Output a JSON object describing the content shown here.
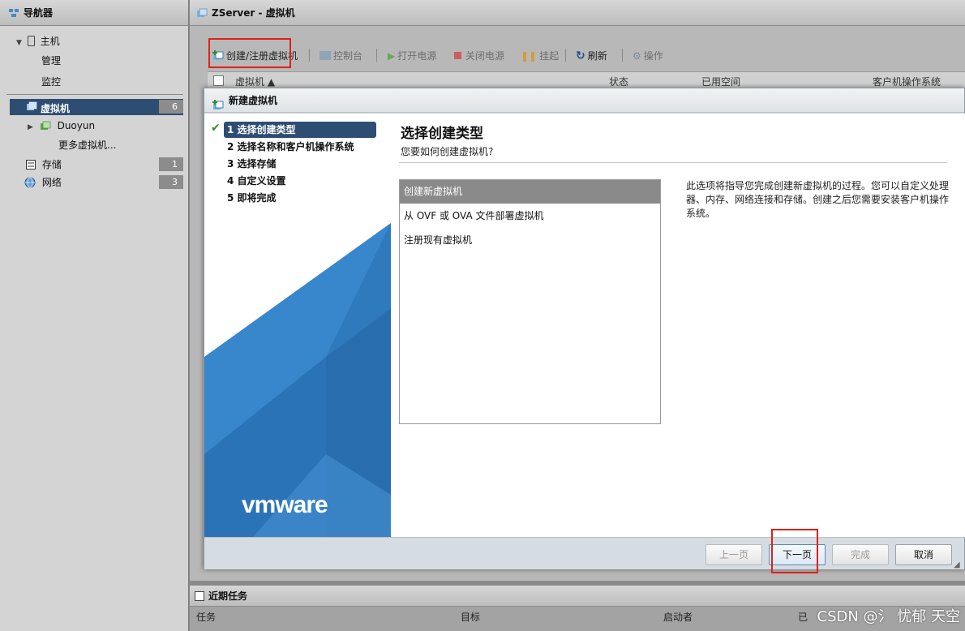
{
  "navigator": {
    "title": "导航器",
    "host": {
      "label": "主机",
      "children": [
        "管理",
        "监控"
      ]
    },
    "vms": {
      "label": "虚拟机",
      "count": "6",
      "children": [
        "Duoyun",
        "更多虚拟机..."
      ]
    },
    "storage": {
      "label": "存储",
      "count": "1"
    },
    "network": {
      "label": "网络",
      "count": "3"
    }
  },
  "main": {
    "title": "ZServer - 虚拟机",
    "toolbar": {
      "create": "创建/注册虚拟机",
      "console": "控制台",
      "power_on": "打开电源",
      "power_off": "关闭电源",
      "suspend": "挂起",
      "refresh": "刷新",
      "actions": "操作"
    },
    "columns": [
      "虚拟机 ▲",
      "状态",
      "已用空间",
      "客户机操作系统"
    ]
  },
  "tasks": {
    "title": "近期任务",
    "columns": [
      "任务",
      "目标",
      "启动者",
      "已"
    ]
  },
  "dialog": {
    "title": "新建虚拟机",
    "steps": [
      "1 选择创建类型",
      "2 选择名称和客户机操作系统",
      "3 选择存储",
      "4 自定义设置",
      "5 即将完成"
    ],
    "heading": "选择创建类型",
    "subheading": "您要如何创建虚拟机?",
    "options": [
      "创建新虚拟机",
      "从 OVF 或 OVA 文件部署虚拟机",
      "注册现有虚拟机"
    ],
    "selected_option": 0,
    "description": "此选项将指导您完成创建新虚拟机的过程。您可以自定义处理器、内存、网络连接和存储。创建之后您需要安装客户机操作系统。",
    "logo": "vmware",
    "buttons": {
      "back": "上一页",
      "next": "下一页",
      "finish": "完成",
      "cancel": "取消"
    }
  },
  "watermark": "CSDN @氵 忧郁 天空",
  "colors": {
    "accent": "#2e4d73",
    "highlight_box": "#e0201c",
    "vmware_blue": "#2f79bd"
  }
}
